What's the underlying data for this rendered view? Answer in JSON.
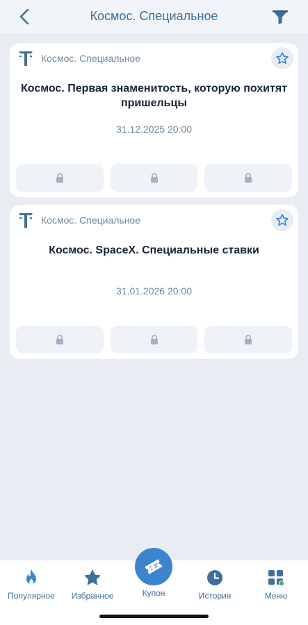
{
  "header": {
    "title": "Космос. Специальное",
    "back_icon": "chevron-left-icon",
    "filter_icon": "filter-icon"
  },
  "events": [
    {
      "category": "Космос. Специальное",
      "title": "Космос. Первая знаменитость, которую похитят пришельцы",
      "date": "31.12.2025 20:00",
      "favorite": false
    },
    {
      "category": "Космос. Специальное",
      "title": "Космос. SpaceX. Специальные ставки",
      "date": "31.01.2026 20:00",
      "favorite": false
    }
  ],
  "nav": {
    "popular": "Популярное",
    "favorites": "Избранное",
    "coupon": "Купон",
    "history": "История",
    "menu": "Меню"
  },
  "colors": {
    "accent": "#3d84cf",
    "title_blue": "#3f6f99",
    "background": "#e9edf3",
    "menu_dot": "#3cb55e"
  }
}
